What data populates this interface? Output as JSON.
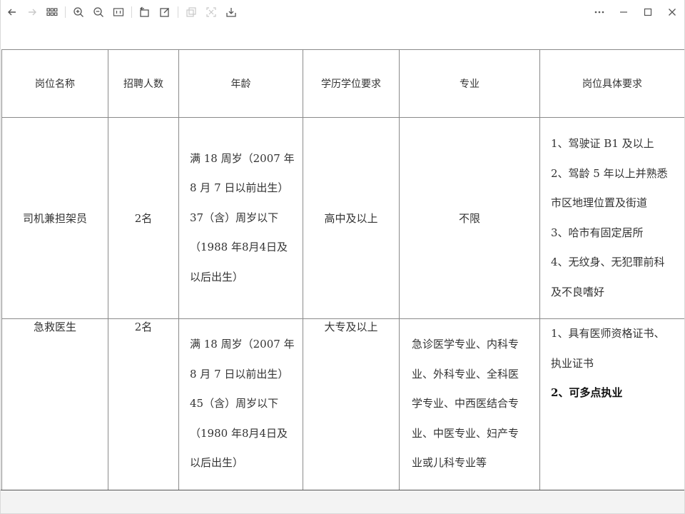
{
  "toolbar": {
    "left_icons": [
      {
        "name": "back-arrow-icon",
        "enabled": true
      },
      {
        "name": "forward-arrow-icon",
        "enabled": false
      },
      {
        "name": "grid-view-icon",
        "enabled": true
      },
      {
        "name": "zoom-in-icon",
        "enabled": true
      },
      {
        "name": "zoom-out-icon",
        "enabled": true
      },
      {
        "name": "actual-size-icon",
        "enabled": true
      },
      {
        "name": "rotate-icon",
        "enabled": true
      },
      {
        "name": "edit-icon",
        "enabled": true
      },
      {
        "name": "copy-icon",
        "enabled": false
      },
      {
        "name": "crop-icon",
        "enabled": false
      },
      {
        "name": "download-icon",
        "enabled": true
      }
    ],
    "right_icons": [
      "more-icon",
      "minimize-icon",
      "maximize-icon",
      "close-icon"
    ]
  },
  "table": {
    "headers": [
      "岗位名称",
      "招聘人数",
      "年龄",
      "学历学位要求",
      "专业",
      "岗位具体要求"
    ],
    "rows": [
      {
        "position": "司机兼担架员",
        "count": "2名",
        "age": [
          "满 18 周岁（2007 年",
          "8 月 7 日以前出生）",
          "37（含）周岁以下",
          "（1988 年8月4日及",
          "以后出生）"
        ],
        "education": "高中及以上",
        "major": "不限",
        "requirements": [
          "1、驾驶证 B1 及以上",
          "2、驾龄 5 年以上并熟悉",
          "市区地理位置及街道",
          "3、哈市有固定居所",
          "4、无纹身、无犯罪前科",
          "及不良嗜好"
        ],
        "requirements_bold": []
      },
      {
        "position": "急救医生",
        "count": "2名",
        "age": [
          "满 18 周岁（2007 年",
          "8 月 7 日以前出生）",
          "45（含）周岁以下",
          "（1980 年8月4日及",
          "以后出生）"
        ],
        "education": "大专及以上",
        "major": [
          "急诊医学专业、内科专",
          "业、外科专业、全科医",
          "学专业、中西医结合专",
          "业、中医专业、妇产专",
          "业或儿科专业等"
        ],
        "requirements": [
          "1、具有医师资格证书、",
          "执业证书"
        ],
        "requirements_bold": [
          "2、可多点执业"
        ]
      }
    ]
  }
}
